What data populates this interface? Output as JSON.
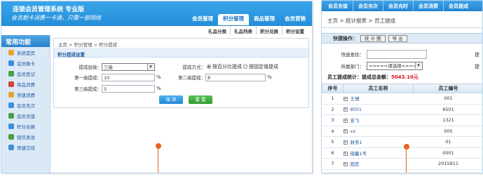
{
  "left": {
    "brand": "连锁会员管理系统 专业版",
    "slogan": "会员刷卡消费一卡通，只需一部网线",
    "nav": [
      "会员管理",
      "积分管理",
      "商品管理",
      "会员营销"
    ],
    "subnav": [
      "礼品分类",
      "礼品列表",
      "积分兑换",
      "积分设置"
    ],
    "sidebar_title": "常用功能",
    "sidebar": [
      {
        "label": "系统首页",
        "color": "#e8a230"
      },
      {
        "label": "会员换卡",
        "color": "#3f8fd8"
      },
      {
        "label": "会员登记",
        "color": "#48a048"
      },
      {
        "label": "商品消费",
        "color": "#d4453a"
      },
      {
        "label": "快速消费",
        "color": "#e8a230"
      },
      {
        "label": "会员充次",
        "color": "#3f8fd8"
      },
      {
        "label": "会员充值",
        "color": "#48a048"
      },
      {
        "label": "积分兑换",
        "color": "#3f8fd8"
      },
      {
        "label": "短信发送",
        "color": "#48a048"
      },
      {
        "label": "快速交班",
        "color": "#3f8fd8"
      }
    ],
    "breadcrumb": "主页 > 积分管理 > 积分提成",
    "panel_title": "积分提成设置",
    "form": {
      "level_label": "提成层级：",
      "level_value": "三级",
      "method_label": "提成方式：",
      "method_opt1": "按百分比提成",
      "method_opt2": "按固定值提成",
      "l1_label": "第一级提成：",
      "l1_value": "10",
      "l2_label": "第二级提成：",
      "l2_value": "8",
      "l3_label": "第三级提成：",
      "l3_value": "5",
      "unit": "%"
    },
    "save_label": "保 存",
    "reset_label": "重 置"
  },
  "right": {
    "nav": [
      "会员充值",
      "会员充次",
      "会员充时",
      "会员消费",
      "会员提成"
    ],
    "breadcrumb": "主页 > 统计报表 > 员工提成",
    "quick_label": "快捷操作：",
    "quick_buttons": [
      "统 计 图",
      "导 出"
    ],
    "search_label": "快速查找：",
    "search_value": "",
    "dept_label": "所属部门：",
    "dept_value": "=====请选择=====",
    "cut1": "提",
    "cut2": "提",
    "stat_label": "员工提成统计：提成总金额：",
    "stat_amount": "5043.10元",
    "columns": [
      "序号",
      "员工名称",
      "员工编号"
    ],
    "rows": [
      {
        "no": "1",
        "name": "王博",
        "code": "001"
      },
      {
        "no": "2",
        "name": "8501",
        "code": "8501"
      },
      {
        "no": "3",
        "name": "安飞",
        "code": "1321"
      },
      {
        "no": "4",
        "name": "xx",
        "code": "005"
      },
      {
        "no": "5",
        "name": "财务1",
        "code": "01"
      },
      {
        "no": "6",
        "name": "储蓄1号",
        "code": "0001"
      },
      {
        "no": "7",
        "name": "固定",
        "code": "2015811"
      }
    ]
  }
}
